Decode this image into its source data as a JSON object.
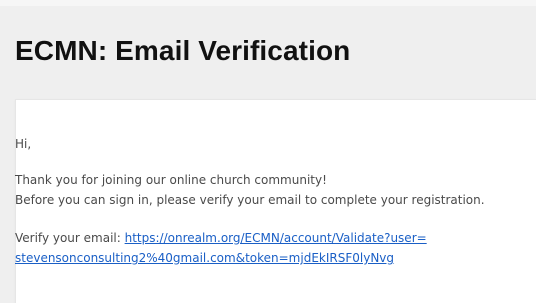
{
  "email": {
    "title": "ECMN: Email Verification",
    "greeting": "Hi,",
    "body_line_1": "Thank you for joining our online church community!",
    "body_line_2": "Before you can sign in, please verify your email to complete your registration.",
    "verify_label": "Verify your email:",
    "verify_link_part_1": "https://onrealm.org/ECMN/account/Validate?user=",
    "verify_link_part_2": "stevensonconsulting2%40gmail.com&token=mjdEkIRSF0lyNvg"
  },
  "colors": {
    "background": "#efefef",
    "card": "#ffffff",
    "title": "#111111",
    "body_text": "#4a4a4a",
    "link": "#1a5fc6"
  }
}
